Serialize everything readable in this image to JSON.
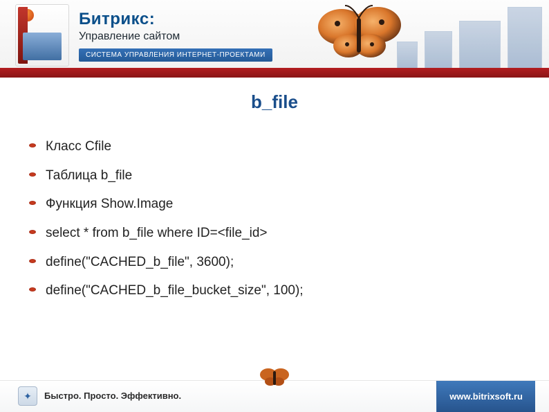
{
  "header": {
    "brand_name": "Битрикс:",
    "brand_sub": "Управление сайтом",
    "tagline": "СИСТЕМА УПРАВЛЕНИЯ ИНТЕРНЕТ-ПРОЕКТАМИ"
  },
  "content": {
    "title": "b_file",
    "items": [
      "Класс Cfile",
      "Таблица b_file",
      "Функция Show.Image",
      "select * from b_file where ID=<file_id>",
      "define(\"CACHED_b_file\", 3600);",
      "define(\"CACHED_b_file_bucket_size\", 100);"
    ]
  },
  "footer": {
    "slogan": "Быстро. Просто. Эффективно.",
    "site": "www.bitrixsoft.ru"
  }
}
